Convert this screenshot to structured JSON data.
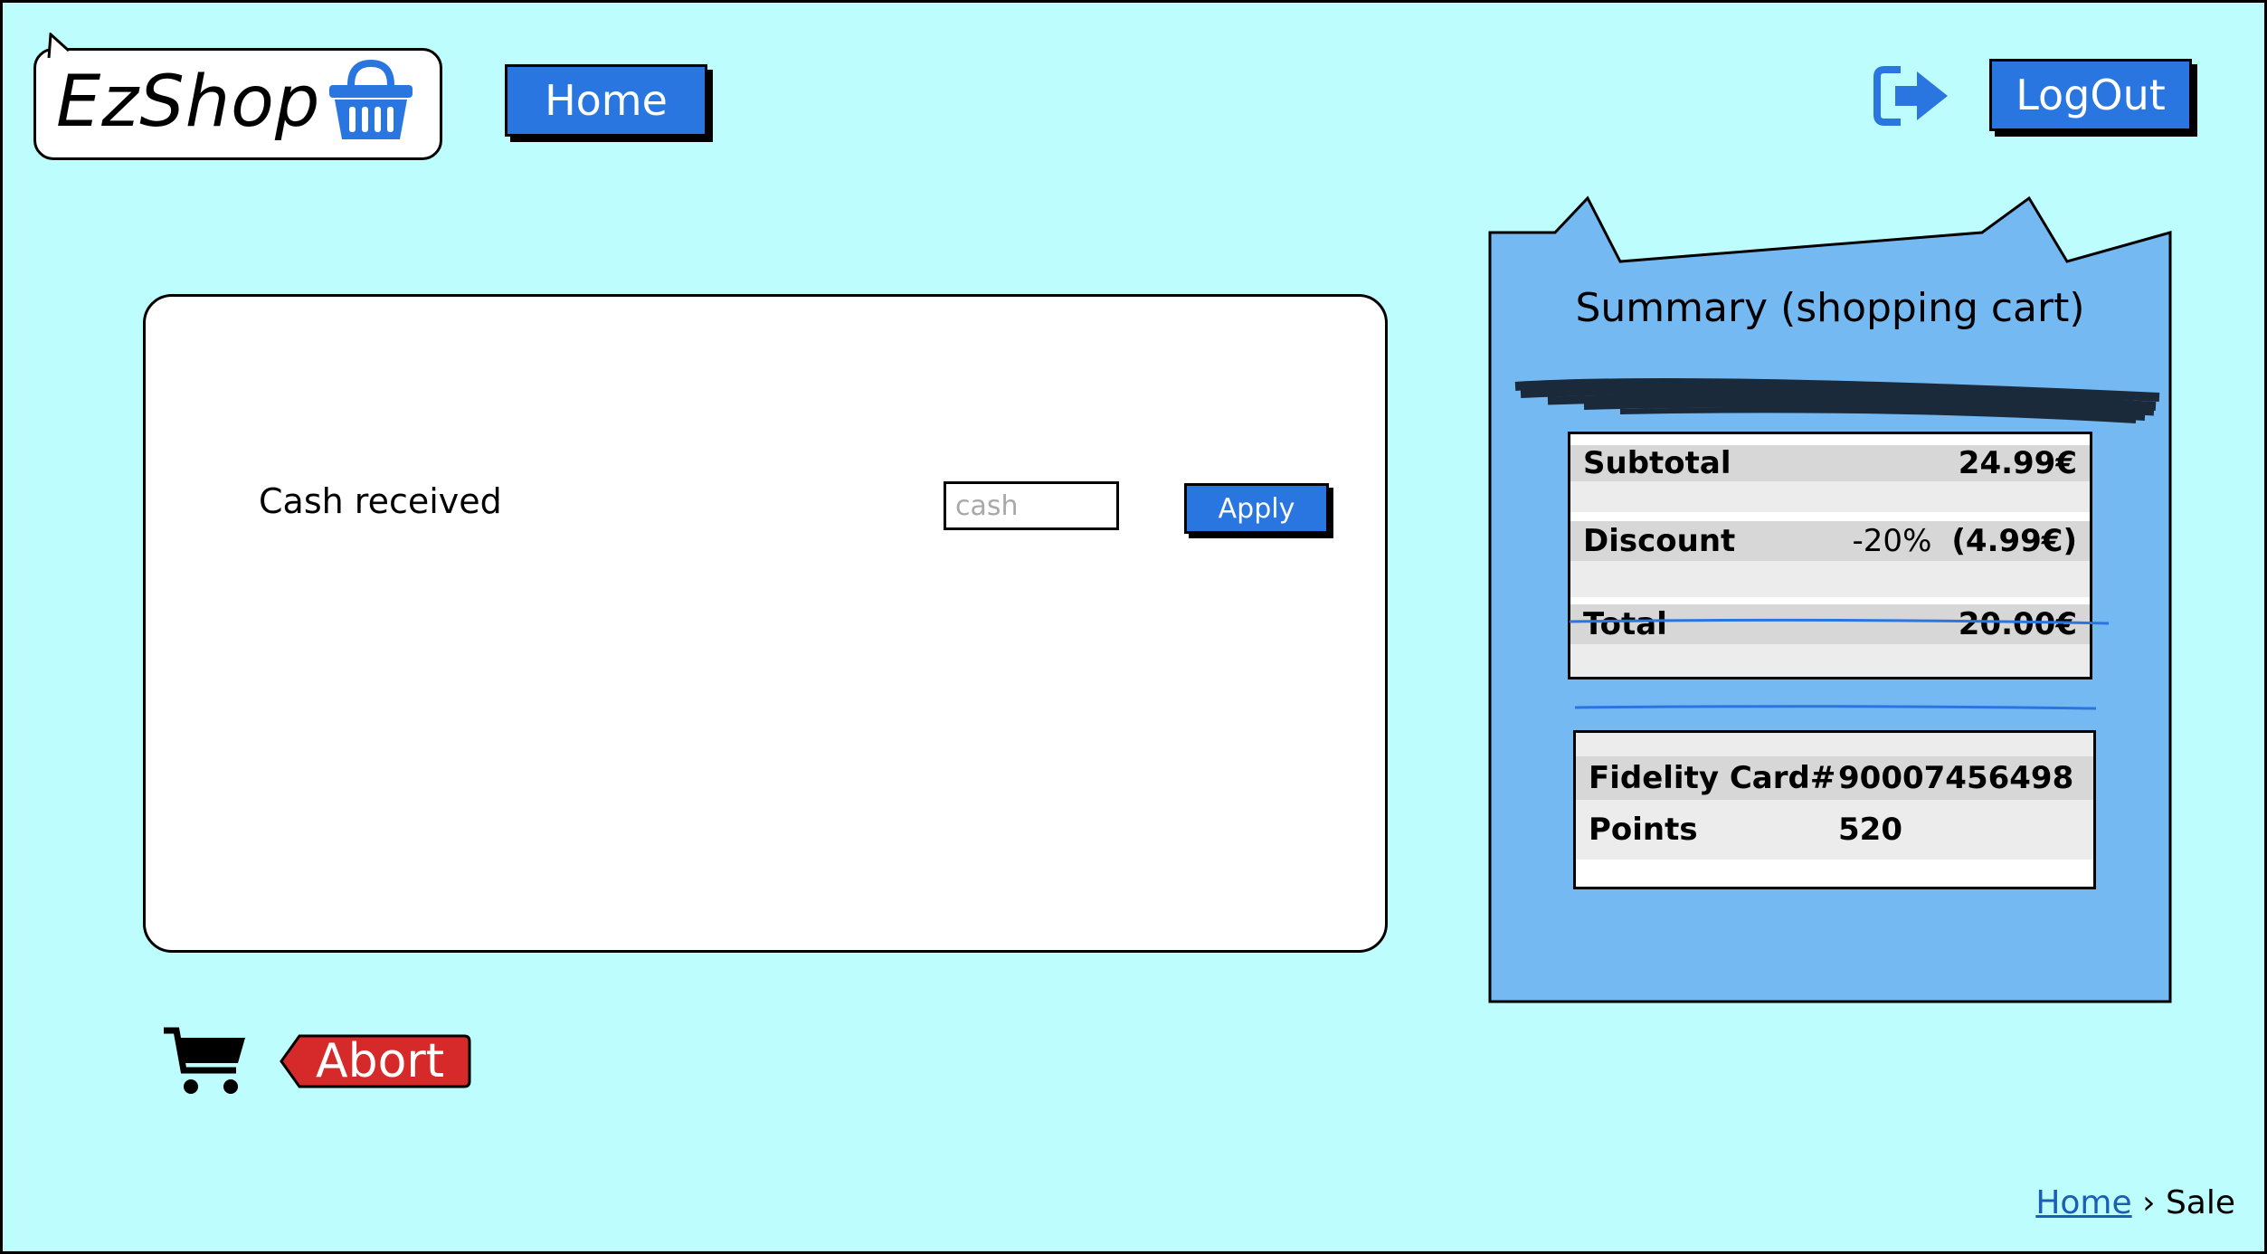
{
  "app": {
    "logo_text": "EzShop",
    "accent_color": "#2a76e0",
    "background_color": "#bdfdfd",
    "danger_color": "#d62a2a"
  },
  "header": {
    "home_label": "Home",
    "logout_label": "LogOut",
    "logout_icon": "sign-out-icon",
    "basket_icon": "basket-icon"
  },
  "payment": {
    "cash_label": "Cash received",
    "cash_placeholder": "cash",
    "cash_value": "",
    "apply_label": "Apply"
  },
  "summary": {
    "title": "Summary (shopping cart)",
    "subtotal_label": "Subtotal",
    "subtotal_value": "24.99€",
    "discount_label": "Discount",
    "discount_percent": "-20%",
    "discount_value": "(4.99€)",
    "total_label": "Total",
    "total_value": "20.00€",
    "fidelity_label": "Fidelity Card#",
    "fidelity_value": "90007456498",
    "points_label": "Points",
    "points_value": "520"
  },
  "footer": {
    "cart_icon": "cart-icon",
    "abort_label": "Abort"
  },
  "breadcrumb": {
    "home": "Home",
    "separator": "›",
    "current": "Sale"
  }
}
